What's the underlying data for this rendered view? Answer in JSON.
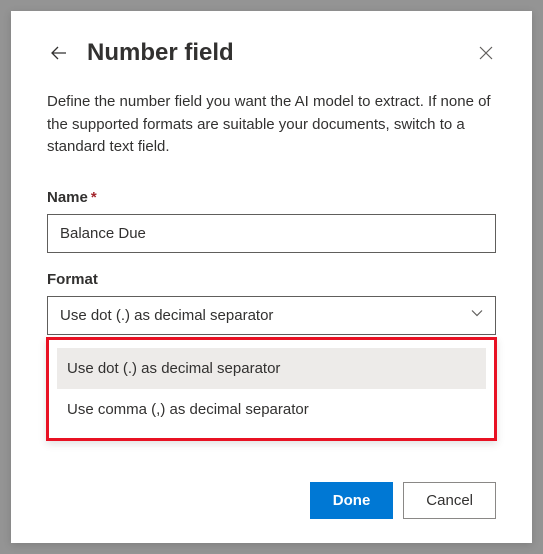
{
  "dialog": {
    "title": "Number field",
    "description": "Define the number field you want the AI model to extract. If none of the supported formats are suitable your documents, switch to a standard text field."
  },
  "fields": {
    "name": {
      "label": "Name",
      "required": "*",
      "value": "Balance Due"
    },
    "format": {
      "label": "Format",
      "selected": "Use dot (.) as decimal separator",
      "options": [
        "Use dot (.) as decimal separator",
        "Use comma (,) as decimal separator"
      ]
    }
  },
  "buttons": {
    "done": "Done",
    "cancel": "Cancel"
  }
}
